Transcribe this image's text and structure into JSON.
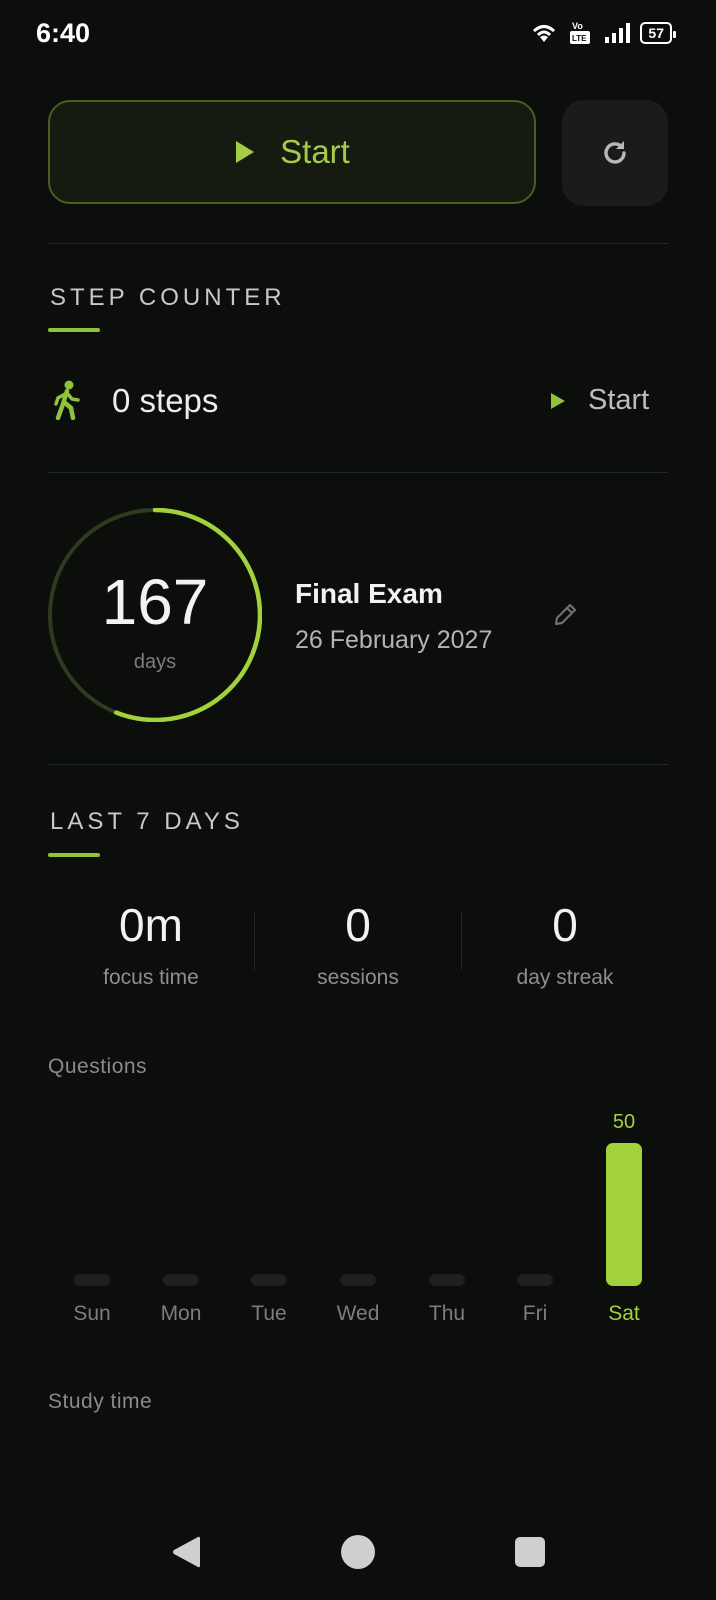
{
  "status_bar": {
    "time": "6:40",
    "battery": "57"
  },
  "controls": {
    "start_label": "Start",
    "reset_icon": "refresh-icon"
  },
  "step_counter": {
    "title": "STEP COUNTER",
    "steps_text": "0 steps",
    "start_label": "Start"
  },
  "countdown": {
    "days": "167",
    "unit": "days",
    "exam_name": "Final Exam",
    "exam_date": "26 February 2027",
    "progress_fraction": 0.56
  },
  "last7": {
    "title": "LAST 7 DAYS",
    "stats": [
      {
        "value": "0m",
        "label": "focus time"
      },
      {
        "value": "0",
        "label": "sessions"
      },
      {
        "value": "0",
        "label": "day streak"
      }
    ]
  },
  "questions": {
    "title": "Questions"
  },
  "study_time": {
    "title": "Study time"
  },
  "accent_color": "#a2d13b",
  "chart_data": {
    "type": "bar",
    "categories": [
      "Sun",
      "Mon",
      "Tue",
      "Wed",
      "Thu",
      "Fri",
      "Sat"
    ],
    "values": [
      0,
      0,
      0,
      0,
      0,
      0,
      50
    ],
    "data_labels": [
      "",
      "",
      "",
      "",
      "",
      "",
      "50"
    ],
    "highlight": "Sat"
  }
}
